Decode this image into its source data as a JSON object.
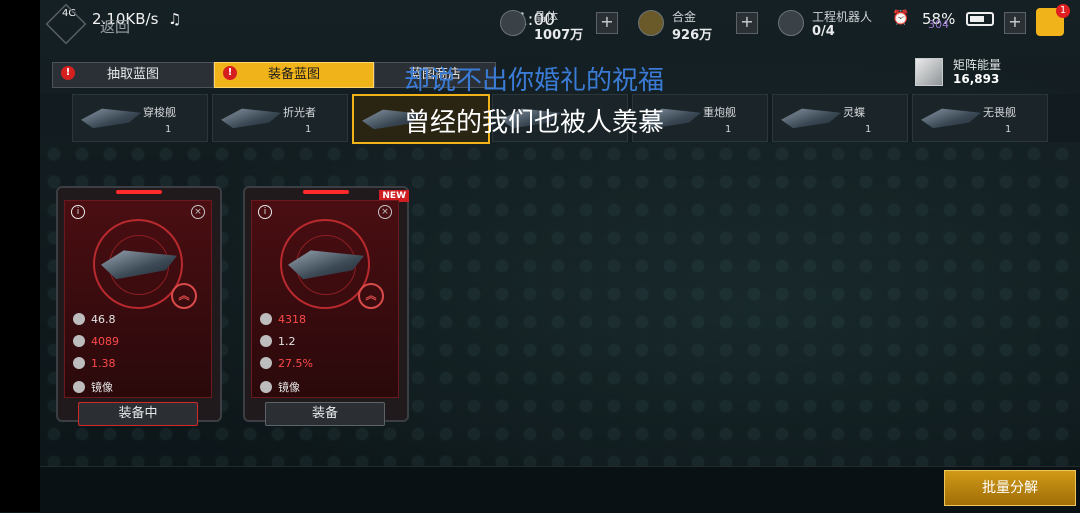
{
  "status_bar": {
    "network": "4G",
    "speed": "2.10KB/s",
    "time": "11:00",
    "battery": "58%"
  },
  "header": {
    "back_label": "返回",
    "resources": [
      {
        "label": "晶体",
        "value": "1007万"
      },
      {
        "label": "合金",
        "value": "926万"
      },
      {
        "label": "工程机器人",
        "value": "0/4"
      }
    ],
    "extra_count": "304",
    "cart_badge": "1"
  },
  "tabs": [
    {
      "label": "抽取蓝图",
      "alert": "!"
    },
    {
      "label": "装备蓝图",
      "alert": "!"
    },
    {
      "label": "蓝图商店"
    }
  ],
  "energy": {
    "label": "矩阵能量",
    "value": "16,893"
  },
  "ships": [
    {
      "name": "穿梭舰",
      "count": "1"
    },
    {
      "name": "折光者",
      "count": "1"
    },
    {
      "name": "",
      "count": ""
    },
    {
      "name": "",
      "count": ""
    },
    {
      "name": "重炮舰",
      "count": "1"
    },
    {
      "name": "灵蝶",
      "count": "1"
    },
    {
      "name": "无畏舰",
      "count": "1"
    }
  ],
  "lyrics": {
    "line1": "却说不出你婚礼的祝福",
    "line2": "曾经的我们也被人羡慕"
  },
  "cards": [
    {
      "stats": [
        {
          "value": "46.8",
          "highlight": false
        },
        {
          "value": "4089",
          "highlight": true
        },
        {
          "value": "1.38",
          "highlight": true
        },
        {
          "value": "镜像",
          "highlight": false
        }
      ],
      "button": "装备中",
      "new": ""
    },
    {
      "stats": [
        {
          "value": "4318",
          "highlight": true
        },
        {
          "value": "1.2",
          "highlight": false
        },
        {
          "value": "27.5%",
          "highlight": true
        },
        {
          "value": "镜像",
          "highlight": false
        }
      ],
      "button": "装备",
      "new": "NEW"
    }
  ],
  "batch_button": "批量分解",
  "colors": {
    "accent": "#f0b41a",
    "alert": "#d62020",
    "card_red": "#4a0e12"
  }
}
